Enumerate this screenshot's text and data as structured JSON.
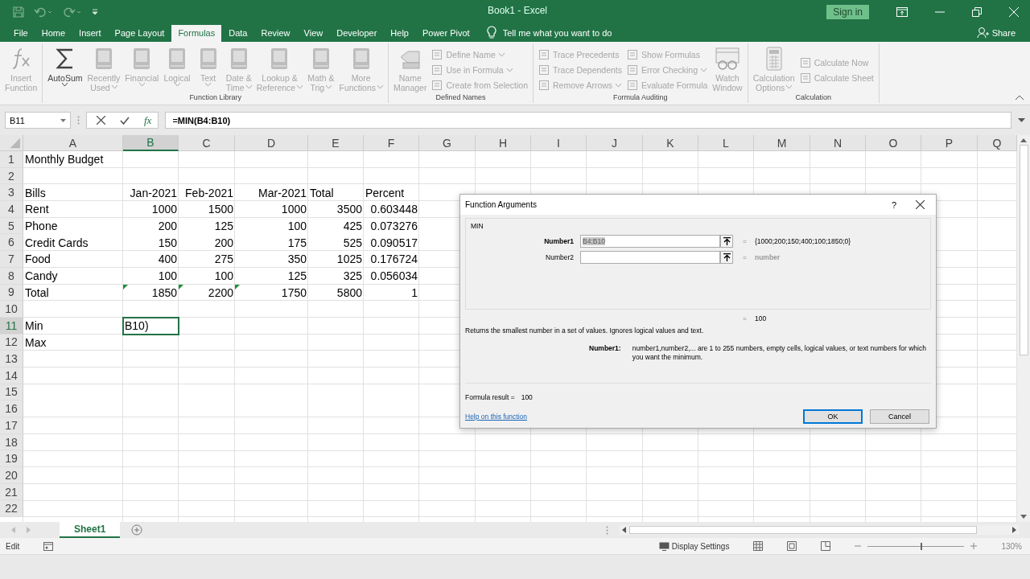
{
  "window": {
    "title": "Book1 - Excel",
    "sign_in": "Sign in"
  },
  "tabs": [
    {
      "label": "File",
      "selected": false
    },
    {
      "label": "Home",
      "selected": false
    },
    {
      "label": "Insert",
      "selected": false
    },
    {
      "label": "Page Layout",
      "selected": false
    },
    {
      "label": "Formulas",
      "selected": true
    },
    {
      "label": "Data",
      "selected": false
    },
    {
      "label": "Review",
      "selected": false
    },
    {
      "label": "View",
      "selected": false
    },
    {
      "label": "Developer",
      "selected": false
    },
    {
      "label": "Help",
      "selected": false
    },
    {
      "label": "Power Pivot",
      "selected": false
    }
  ],
  "tell_me": "Tell me what you want to do",
  "share": "Share",
  "ribbon": {
    "groups": [
      {
        "items": [
          {
            "kind": "large",
            "lines": [
              "Insert",
              "Function"
            ],
            "disabled": true,
            "dropdown": false
          }
        ]
      },
      {
        "label": "Function Library",
        "items": [
          {
            "kind": "large",
            "lines": [
              "AutoSum"
            ],
            "disabled": false,
            "dropdown": true
          },
          {
            "kind": "large",
            "lines": [
              "Recently",
              "Used"
            ],
            "disabled": true,
            "dropdown": true
          },
          {
            "kind": "large",
            "lines": [
              "Financial"
            ],
            "disabled": true,
            "dropdown": true
          },
          {
            "kind": "large",
            "lines": [
              "Logical"
            ],
            "disabled": true,
            "dropdown": true
          },
          {
            "kind": "large",
            "lines": [
              "Text"
            ],
            "disabled": true,
            "dropdown": true
          },
          {
            "kind": "large",
            "lines": [
              "Date &",
              "Time"
            ],
            "disabled": true,
            "dropdown": true
          },
          {
            "kind": "large",
            "lines": [
              "Lookup &",
              "Reference"
            ],
            "disabled": true,
            "dropdown": true
          },
          {
            "kind": "large",
            "lines": [
              "Math &",
              "Trig"
            ],
            "disabled": true,
            "dropdown": true
          },
          {
            "kind": "large",
            "lines": [
              "More",
              "Functions"
            ],
            "disabled": true,
            "dropdown": true
          }
        ]
      },
      {
        "label": "Defined Names",
        "items": [
          {
            "kind": "large",
            "lines": [
              "Name",
              "Manager"
            ],
            "disabled": true,
            "dropdown": false
          },
          {
            "kind": "small",
            "lines": [
              "Define Name"
            ],
            "disabled": true,
            "dropdown": true
          },
          {
            "kind": "small",
            "lines": [
              "Use in Formula"
            ],
            "disabled": true,
            "dropdown": true
          },
          {
            "kind": "small",
            "lines": [
              "Create from Selection"
            ],
            "disabled": true,
            "dropdown": false
          }
        ]
      },
      {
        "label": "Formula Auditing",
        "items": [
          {
            "kind": "small",
            "lines": [
              "Trace Precedents"
            ],
            "disabled": true,
            "dropdown": false
          },
          {
            "kind": "small",
            "lines": [
              "Trace Dependents"
            ],
            "disabled": true,
            "dropdown": false
          },
          {
            "kind": "small",
            "lines": [
              "Remove Arrows"
            ],
            "disabled": true,
            "dropdown": true
          },
          {
            "kind": "small",
            "lines": [
              "Show Formulas"
            ],
            "disabled": true,
            "dropdown": false
          },
          {
            "kind": "small",
            "lines": [
              "Error Checking"
            ],
            "disabled": true,
            "dropdown": true
          },
          {
            "kind": "small",
            "lines": [
              "Evaluate Formula"
            ],
            "disabled": true,
            "dropdown": false
          },
          {
            "kind": "large",
            "lines": [
              "Watch",
              "Window"
            ],
            "disabled": true,
            "dropdown": false
          }
        ]
      },
      {
        "label": "Calculation",
        "items": [
          {
            "kind": "large",
            "lines": [
              "Calculation",
              "Options"
            ],
            "disabled": true,
            "dropdown": true
          },
          {
            "kind": "small",
            "lines": [
              "Calculate Now"
            ],
            "disabled": true,
            "dropdown": false
          },
          {
            "kind": "small",
            "lines": [
              "Calculate Sheet"
            ],
            "disabled": true,
            "dropdown": false
          }
        ]
      }
    ]
  },
  "formula_bar": {
    "name_box": "B11",
    "insert_function": "fx",
    "formula": "=**MIN(B4:B10)**"
  },
  "sheet": {
    "columns": [
      {
        "label": "A",
        "selected": false
      },
      {
        "label": "B",
        "selected": true
      },
      {
        "label": "C",
        "selected": false
      },
      {
        "label": "D",
        "selected": false
      },
      {
        "label": "E",
        "selected": false
      },
      {
        "label": "F",
        "selected": false
      },
      {
        "label": "G",
        "selected": false
      },
      {
        "label": "H",
        "selected": false
      },
      {
        "label": "I",
        "selected": false
      },
      {
        "label": "J",
        "selected": false
      },
      {
        "label": "K",
        "selected": false
      },
      {
        "label": "L",
        "selected": false
      },
      {
        "label": "M",
        "selected": false
      },
      {
        "label": "N",
        "selected": false
      },
      {
        "label": "O",
        "selected": false
      },
      {
        "label": "P",
        "selected": false
      },
      {
        "label": "Q",
        "selected": false
      }
    ],
    "rows": [
      {
        "number": "1",
        "selected": false,
        "cells": [
          {
            "text": "Monthly Budget",
            "numeric": false
          }
        ]
      },
      {
        "number": "2",
        "selected": false
      },
      {
        "number": "3",
        "selected": false,
        "cells": [
          {
            "text": "Bills",
            "numeric": false
          },
          {
            "text": "Jan-2021",
            "numeric": true
          },
          {
            "text": "Feb-2021",
            "numeric": true
          },
          {
            "text": "Mar-2021",
            "numeric": true
          },
          {
            "text": "Total",
            "numeric": false
          },
          {
            "text": "Percent",
            "numeric": false
          }
        ]
      },
      {
        "number": "4",
        "selected": false,
        "cells": [
          {
            "text": "Rent",
            "numeric": false
          },
          {
            "text": "1000",
            "numeric": true
          },
          {
            "text": "1500",
            "numeric": true
          },
          {
            "text": "1000",
            "numeric": true
          },
          {
            "text": "3500",
            "numeric": true
          },
          {
            "text": "0.603448",
            "numeric": true
          }
        ]
      },
      {
        "number": "5",
        "selected": false,
        "cells": [
          {
            "text": "Phone",
            "numeric": false
          },
          {
            "text": "200",
            "numeric": true
          },
          {
            "text": "125",
            "numeric": true
          },
          {
            "text": "100",
            "numeric": true
          },
          {
            "text": "425",
            "numeric": true
          },
          {
            "text": "0.073276",
            "numeric": true
          }
        ]
      },
      {
        "number": "6",
        "selected": false,
        "cells": [
          {
            "text": "Credit Cards",
            "numeric": false
          },
          {
            "text": "150",
            "numeric": true
          },
          {
            "text": "200",
            "numeric": true
          },
          {
            "text": "175",
            "numeric": true
          },
          {
            "text": "525",
            "numeric": true
          },
          {
            "text": "0.090517",
            "numeric": true
          }
        ]
      },
      {
        "number": "7",
        "selected": false,
        "cells": [
          {
            "text": "Food",
            "numeric": false
          },
          {
            "text": "400",
            "numeric": true
          },
          {
            "text": "275",
            "numeric": true
          },
          {
            "text": "350",
            "numeric": true
          },
          {
            "text": "1025",
            "numeric": true
          },
          {
            "text": "0.176724",
            "numeric": true
          }
        ]
      },
      {
        "number": "8",
        "selected": false,
        "cells": [
          {
            "text": "Candy",
            "numeric": false
          },
          {
            "text": "100",
            "numeric": true
          },
          {
            "text": "100",
            "numeric": true
          },
          {
            "text": "125",
            "numeric": true
          },
          {
            "text": "325",
            "numeric": true
          },
          {
            "text": "0.056034",
            "numeric": true
          }
        ]
      },
      {
        "number": "9",
        "selected": false,
        "cells": [
          {
            "text": "Total",
            "numeric": false
          },
          {
            "text": "1850",
            "numeric": true,
            "flag": true
          },
          {
            "text": "2200",
            "numeric": true,
            "flag": true
          },
          {
            "text": "1750",
            "numeric": true,
            "flag": true
          },
          {
            "text": "5800",
            "numeric": true
          },
          {
            "text": "1",
            "numeric": true
          }
        ]
      },
      {
        "number": "10",
        "selected": false
      },
      {
        "number": "11",
        "selected": true,
        "cells": [
          {
            "text": "Min",
            "numeric": false
          },
          {
            "text": "B10)",
            "numeric": false,
            "selected": true
          }
        ]
      },
      {
        "number": "12",
        "selected": false,
        "cells": [
          {
            "text": "Max",
            "numeric": false
          }
        ]
      },
      {
        "number": "13",
        "selected": false
      },
      {
        "number": "14",
        "selected": false
      },
      {
        "number": "15",
        "selected": false
      },
      {
        "number": "16",
        "selected": false
      },
      {
        "number": "17",
        "selected": false
      },
      {
        "number": "18",
        "selected": false
      },
      {
        "number": "19",
        "selected": false
      },
      {
        "number": "20",
        "selected": false
      },
      {
        "number": "21",
        "selected": false
      },
      {
        "number": "22",
        "selected": false
      }
    ]
  },
  "dialog": {
    "title": "Function Arguments",
    "help": "?",
    "function": "MIN",
    "arguments": [
      {
        "label": "Number1",
        "active": true,
        "value": "B4:B10",
        "equals": "=",
        "result": "{1000;200;150;400;100;1850;0}"
      },
      {
        "label": "Number2",
        "active": false,
        "equals": "=",
        "result": "number"
      }
    ],
    "result_equals": "=",
    "result": "100",
    "description": "Returns the smallest number in a set of values. Ignores logical values and text.",
    "argument_help_label": "Number1:",
    "argument_help": "number1,number2,... are 1 to 255 numbers, empty cells, logical values, or text numbers for which you want the minimum.",
    "formula_result_label": "Formula result =",
    "formula_result": "100",
    "help_link": "Help on this function",
    "ok": "OK",
    "cancel": "Cancel"
  },
  "sheet_tabs": [
    {
      "label": "Sheet1",
      "selected": true
    }
  ],
  "status_bar": {
    "mode": "Edit",
    "display_settings": "Display Settings",
    "zoom": {
      "level": 0.55,
      "reading": "130%"
    }
  }
}
